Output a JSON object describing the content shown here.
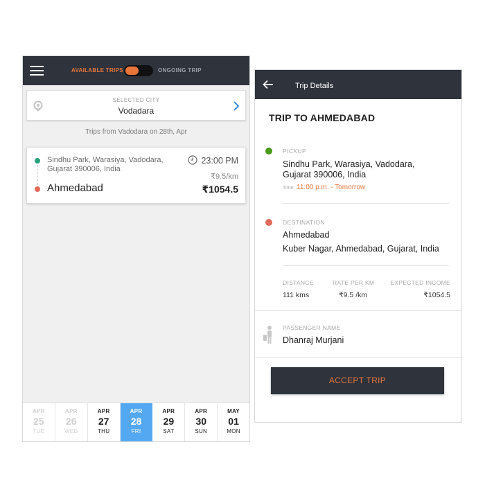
{
  "left_screen": {
    "header": {
      "available_label": "AVAILABLE TRIPS",
      "ongoing_label": "ONGOING TRIP"
    },
    "city": {
      "label": "SELECTED CITY",
      "value": "Vodadara"
    },
    "trips_heading": "Trips from Vadodara on 28th, Apr",
    "trip": {
      "pickup_line1": "Sindhu Park, Warasiya, Vadodara,",
      "pickup_line2": "Gujarat 390006, India",
      "destination": "Ahmedabad",
      "time": "23:00 PM",
      "rate": "₹9.5/km",
      "fare": "₹1054.5"
    },
    "dates": [
      {
        "month": "APR",
        "day": "25",
        "weekday": "TUE",
        "state": "past"
      },
      {
        "month": "APR",
        "day": "26",
        "weekday": "WED",
        "state": "past"
      },
      {
        "month": "APR",
        "day": "27",
        "weekday": "THU",
        "state": "normal"
      },
      {
        "month": "APR",
        "day": "28",
        "weekday": "FRI",
        "state": "active"
      },
      {
        "month": "APR",
        "day": "29",
        "weekday": "SAT",
        "state": "normal"
      },
      {
        "month": "APR",
        "day": "30",
        "weekday": "SUN",
        "state": "normal"
      },
      {
        "month": "MAY",
        "day": "01",
        "weekday": "MON",
        "state": "normal"
      }
    ]
  },
  "right_screen": {
    "header_title": "Trip Details",
    "trip_title": "TRIP TO AHMEDABAD",
    "pickup": {
      "label": "PICKUP",
      "line1": "Sindhu Park, Warasiya, Vadodara,",
      "line2": "Gujarat 390006, India",
      "time_label": "Time:",
      "time_value": "11:00 p.m. - Tomorrow"
    },
    "destination": {
      "label": "DESTINATION",
      "line1": "Ahmedabad",
      "line2": "Kuber Nagar, Ahmedabad, Gujarat, India"
    },
    "stats": {
      "distance_label": "DISTANCE",
      "distance_value": "111 kms",
      "rate_label": "RATE PER KM",
      "rate_value": "₹9.5 /km",
      "income_label": "EXPECTED INCOME",
      "income_value": "₹1054.5"
    },
    "passenger": {
      "label": "PASSENGER NAME",
      "value": "Dhanraj Murjani"
    },
    "accept_label": "ACCEPT TRIP"
  },
  "colors": {
    "header_bg": "#2e333c",
    "accent_orange": "#e8763a",
    "active_date_blue": "#54a8f2",
    "pickup_green": "#2aa27a",
    "destination_red": "#e26b5b"
  }
}
